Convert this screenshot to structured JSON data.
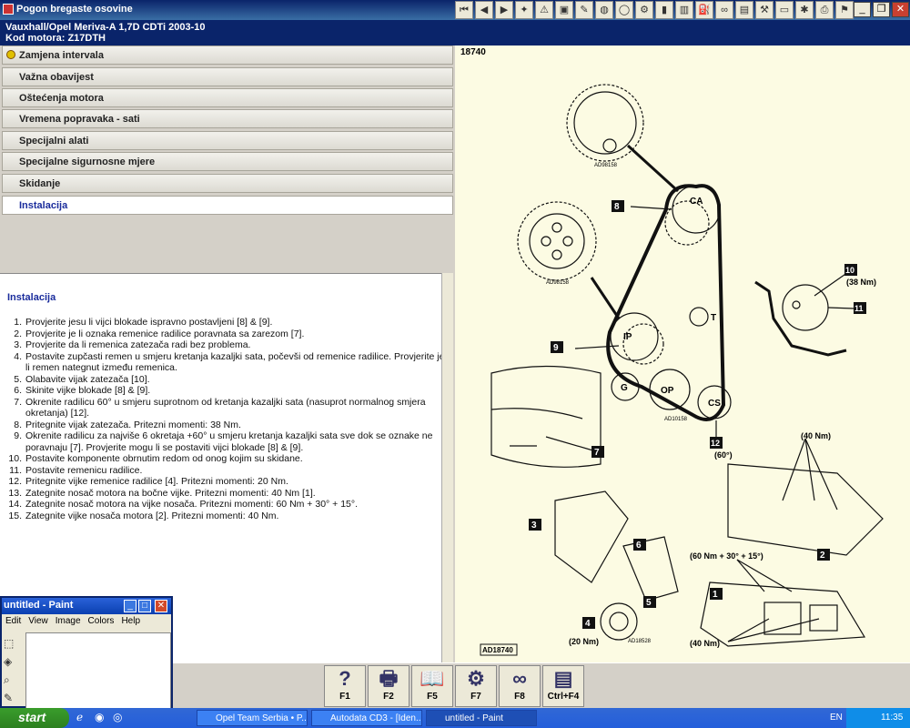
{
  "window": {
    "title": "Pogon bregaste osovine",
    "controls": {
      "minimize": "_",
      "restore": "❐",
      "close": "✕"
    }
  },
  "toolbar_icons": [
    "first-icon",
    "prev-icon",
    "next-icon",
    "lightbulb-icon",
    "warning-icon",
    "monitor-icon",
    "service-icon",
    "wheel-icon",
    "tyre-icon",
    "engine-icon",
    "battery-icon",
    "filter-icon",
    "oil-icon",
    "belt-icon",
    "book-icon",
    "tools-icon",
    "display-icon",
    "gear-icon",
    "print-icon",
    "settings-icon"
  ],
  "vehicle": {
    "line1": "Vauxhall/Opel   Meriva-A  1,7D CDTi 2003-10",
    "line2": "Kod motora: Z17DTH"
  },
  "menu": [
    {
      "label": "Zamjena intervala",
      "selected": false,
      "marker": true
    },
    {
      "label": "Važna obavijest",
      "selected": false
    },
    {
      "label": "Oštećenja motora",
      "selected": false
    },
    {
      "label": "Vremena popravaka - sati",
      "selected": false
    },
    {
      "label": "Specijalni alati",
      "selected": false
    },
    {
      "label": "Specijalne sigurnosne mjere",
      "selected": false
    },
    {
      "label": "Skidanje",
      "selected": false
    },
    {
      "label": "Instalacija",
      "selected": true
    }
  ],
  "section": {
    "heading": "Instalacija",
    "steps": [
      "Provjerite jesu li vijci blokade ispravno postavljeni [8] & [9].",
      "Provjerite je li oznaka remenice radilice poravnata sa zarezom [7].",
      "Provjerite da li remenica zatezača radi bez problema.",
      "Postavite zupčasti remen u smjeru kretanja kazaljki sata, počevši od remenice radilice. Provjerite je li remen nategnut između remenica.",
      "Olabavite vijak zatezača [10].",
      "Skinite vijke blokade [8] & [9].",
      "Okrenite radilicu 60° u smjeru suprotnom od kretanja kazaljki sata (nasuprot normalnog smjera okretanja) [12].",
      "Pritegnite vijak zatezača. Pritezni momenti: 38 Nm.",
      "Okrenite radilicu za najviše 6 okretaja +60° u smjeru kretanja kazaljki sata sve dok se oznake ne poravnaju [7]. Provjerite mogu li se postaviti vijci blokade [8] & [9].",
      "Postavite komponente obrnutim redom od onog kojim su skidane.",
      "Postavite remenicu radilice.",
      "Pritegnite vijke remenice radilice [4]. Pritezni momenti: 20 Nm.",
      "Zategnite nosač motora na bočne vijke. Pritezni momenti: 40 Nm [1].",
      "Zategnite nosač motora na vijke nosača. Pritezni momenti: 60 Nm + 30° + 15°.",
      "Zategnite vijke nosača motora [2]. Pritezni momenti: 40 Nm."
    ]
  },
  "diagram": {
    "ref": "18740",
    "footer_ref": "AD18740",
    "pulleys": {
      "ca": "CA",
      "ip": "IP",
      "t": "T",
      "g": "G",
      "op": "OP",
      "cs": "CS"
    },
    "callouts": [
      "8",
      "9",
      "10",
      "11",
      "12",
      "7",
      "3",
      "6",
      "5",
      "4",
      "1",
      "2"
    ],
    "torques": {
      "t10": "(38 Nm)",
      "t12": "(60°)",
      "t40a": "(40 Nm)",
      "t60": "(60 Nm + 30° + 15°)",
      "t20": "(20 Nm)",
      "t40b": "(40 Nm)"
    },
    "small_refs": {
      "a": "AD98158",
      "b": "AD98158",
      "c": "AD10158",
      "d": "AD18528"
    }
  },
  "function_keys": [
    {
      "key": "F1",
      "icon": "help-icon",
      "glyph": "?"
    },
    {
      "key": "F2",
      "icon": "print-icon",
      "glyph": "🖶"
    },
    {
      "key": "F5",
      "icon": "book-icon",
      "glyph": "📖"
    },
    {
      "key": "F7",
      "icon": "tools-icon",
      "glyph": "⚙"
    },
    {
      "key": "F8",
      "icon": "belt-icon",
      "glyph": "∞"
    },
    {
      "key": "Ctrl+F4",
      "icon": "close-doc-icon",
      "glyph": "▤"
    }
  ],
  "paint": {
    "title": "untitled - Paint",
    "menu": [
      "Edit",
      "View",
      "Image",
      "Colors",
      "Help"
    ]
  },
  "taskbar": {
    "start": "start",
    "tasks": [
      "Opel Team Serbia • P...",
      "Autodata CD3 - [Iden...",
      "untitled - Paint"
    ],
    "lang": "EN",
    "time": "11:35"
  }
}
